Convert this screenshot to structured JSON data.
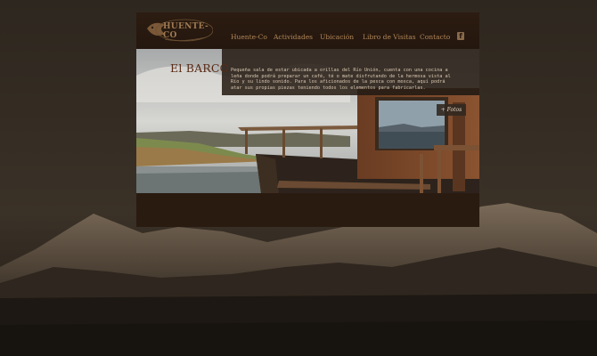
{
  "logo": {
    "text": "HUENTE-CO"
  },
  "nav": {
    "items": [
      {
        "label": "Huente-Co"
      },
      {
        "label": "Actividades"
      },
      {
        "label": "Ubicación"
      },
      {
        "label": "Libro de Visitas"
      },
      {
        "label": "Contacto"
      }
    ],
    "facebook": "f"
  },
  "hero": {
    "title": "El BARCO",
    "description": "Pequeña sala de estar ubicada a orillas del Río Unión, cuenta con una cocina a leña donde podrá preparar un café, té o mate disfrutando de la hermosa vista al Río y su lindo sonido. Para los aficionados de la pesca con mosca, aquí podrá atar sus propias piezas teniendo todos los elementos para fabricarlas.",
    "photos_button": "+ Fotos"
  },
  "colors": {
    "background": "#2b241c",
    "container": "#2a1b11",
    "nav_text": "#b08658",
    "title": "#5a2a14"
  }
}
